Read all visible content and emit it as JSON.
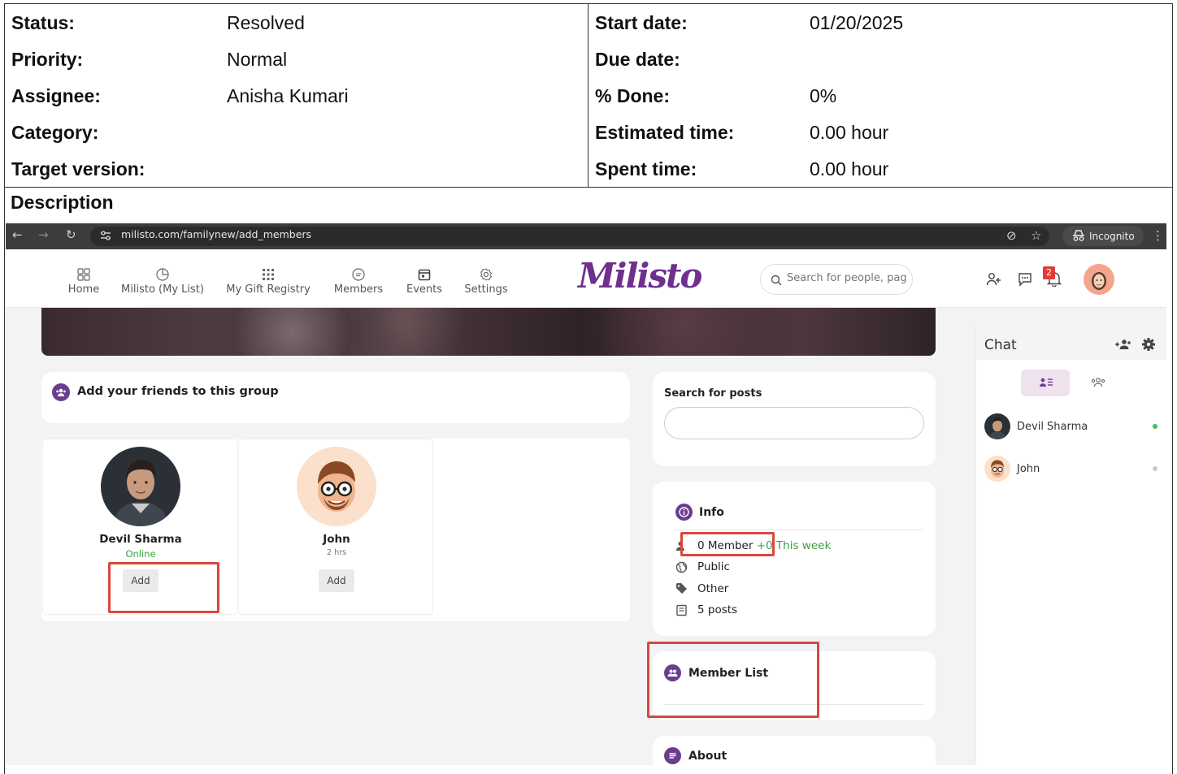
{
  "issue": {
    "left": [
      {
        "label": "Status:",
        "value": "Resolved"
      },
      {
        "label": "Priority:",
        "value": "Normal"
      },
      {
        "label": "Assignee:",
        "value": "Anisha Kumari"
      },
      {
        "label": "Category:",
        "value": ""
      },
      {
        "label": "Target version:",
        "value": ""
      }
    ],
    "right": [
      {
        "label": "Start date:",
        "value": "01/20/2025"
      },
      {
        "label": "Due date:",
        "value": ""
      },
      {
        "label": "% Done:",
        "value": "0%"
      },
      {
        "label": "Estimated time:",
        "value": "0.00 hour"
      },
      {
        "label": "Spent time:",
        "value": "0.00 hour"
      }
    ],
    "description_title": "Description"
  },
  "browser": {
    "url": "milisto.com/familynew/add_members",
    "incognito_label": "Incognito"
  },
  "app": {
    "nav": [
      {
        "label": "Home",
        "icon": "grid-icon"
      },
      {
        "label": "Milisto (My List)",
        "icon": "pie-chart-icon"
      },
      {
        "label": "My Gift Registry",
        "icon": "dots-grid-icon"
      },
      {
        "label": "Members",
        "icon": "chat-bubble-icon"
      },
      {
        "label": "Events",
        "icon": "calendar-icon"
      },
      {
        "label": "Settings",
        "icon": "gear-icon"
      }
    ],
    "logo": "Milisto",
    "search_placeholder": "Search for people, pag",
    "notification_count": "2",
    "colors": {
      "brand": "#6f2f8f",
      "accent": "#6a3d8f",
      "online": "#3aa142",
      "highlight": "#d9473d"
    }
  },
  "add_friends": {
    "title": "Add your friends to this group",
    "friends": [
      {
        "name": "Devil Sharma",
        "status": "Online",
        "action": "Add"
      },
      {
        "name": "John",
        "status": "2 hrs",
        "action": "Add"
      }
    ]
  },
  "search_posts": {
    "title": "Search for posts"
  },
  "info": {
    "title": "Info",
    "members": "0 Member",
    "members_delta": "+0",
    "members_week": "This week",
    "privacy": "Public",
    "category": "Other",
    "posts": "5 posts"
  },
  "member_list": {
    "title": "Member List"
  },
  "about": {
    "title": "About"
  },
  "chat": {
    "title": "Chat",
    "users": [
      {
        "name": "Devil Sharma",
        "online": true
      },
      {
        "name": "John",
        "online": false
      }
    ]
  }
}
